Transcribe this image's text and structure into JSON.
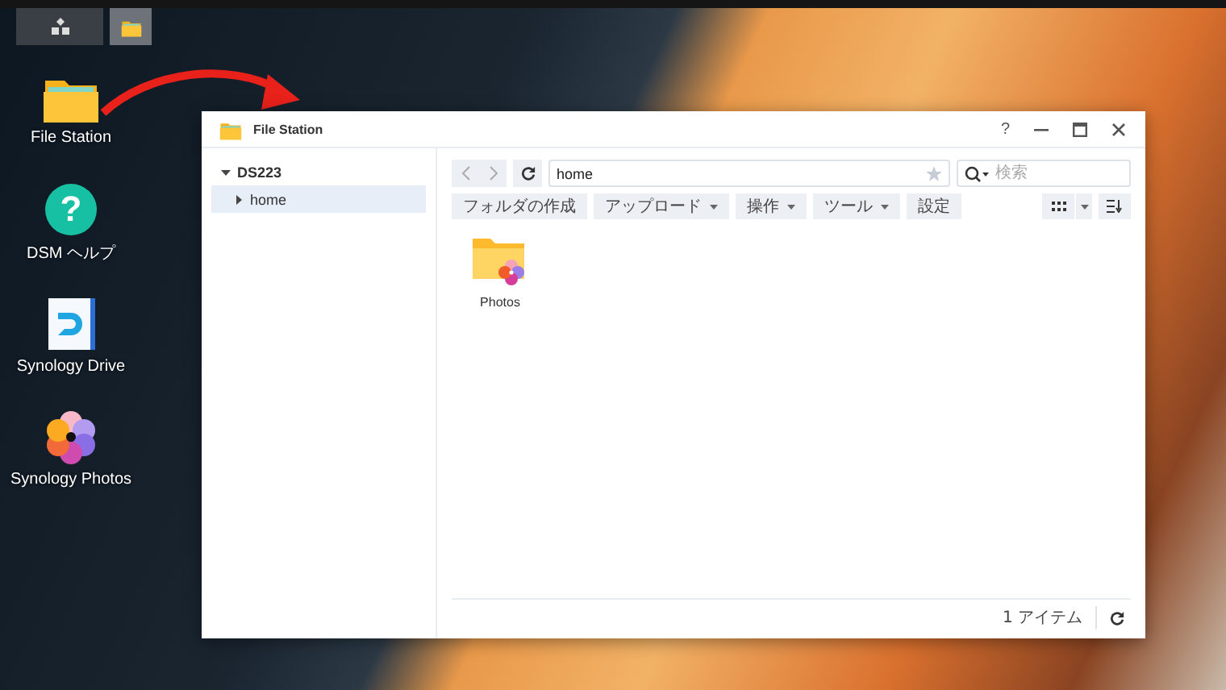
{
  "taskbar": {
    "buttons": [
      {
        "kind": "apps",
        "selected": false
      },
      {
        "kind": "file-station",
        "selected": true
      }
    ]
  },
  "desktop_icons": [
    {
      "kind": "folder",
      "label": "File Station"
    },
    {
      "kind": "help",
      "label": "DSM ヘルプ",
      "glyph": "?"
    },
    {
      "kind": "drive",
      "label": "Synology Drive"
    },
    {
      "kind": "photos",
      "label": "Synology Photos"
    }
  ],
  "window": {
    "title": "File Station",
    "help": "?"
  },
  "sidebar": {
    "items": [
      {
        "label": "DS223",
        "expanded": true,
        "selected": false,
        "children": [
          {
            "label": "home",
            "expanded": false,
            "selected": true
          }
        ]
      }
    ]
  },
  "path": "home",
  "search": {
    "placeholder": "検索"
  },
  "toolbar": [
    {
      "label": "フォルダの作成",
      "dropdown": false
    },
    {
      "label": "アップロード",
      "dropdown": true
    },
    {
      "label": "操作",
      "dropdown": true
    },
    {
      "label": "ツール",
      "dropdown": true
    },
    {
      "label": "設定",
      "dropdown": false
    }
  ],
  "files": [
    {
      "kind": "photos-folder",
      "name": "Photos"
    }
  ],
  "status_bar": {
    "count": "1 アイテム"
  }
}
